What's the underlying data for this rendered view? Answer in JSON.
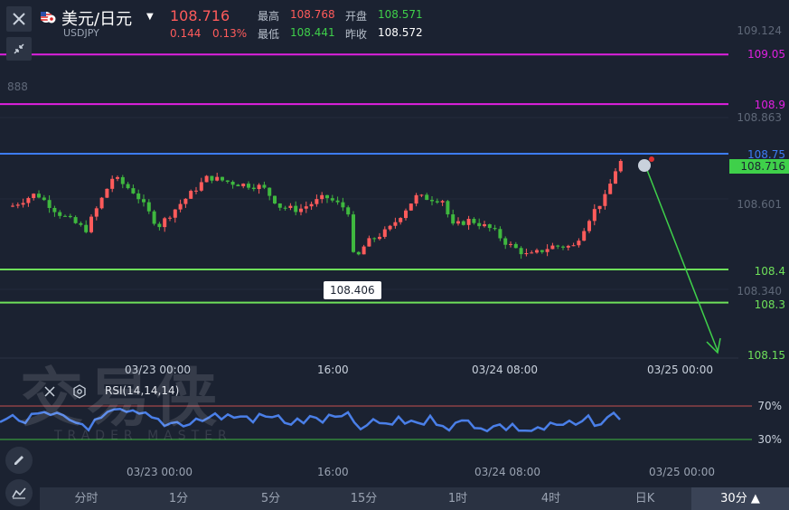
{
  "header": {
    "title": "美元/日元",
    "symbol": "USDJPY",
    "price": "108.716",
    "change": "0.144",
    "change_pct": "0.13%",
    "high_label": "最高",
    "high_value": "108.768",
    "low_label": "最低",
    "low_value": "108.441",
    "open_label": "开盘",
    "open_value": "108.571",
    "prev_close_label": "昨收",
    "prev_close_value": "108.572"
  },
  "y_axis": {
    "ticks": [
      "109.124",
      "888",
      "108.863",
      "108.601",
      "108.340"
    ]
  },
  "levels": [
    {
      "value": "109.05",
      "color": "#e020e0"
    },
    {
      "value": "108.9",
      "color": "#e020e0"
    },
    {
      "value": "108.75",
      "color": "#3d7cf5"
    },
    {
      "value": "108.4",
      "color": "#6ee05a"
    },
    {
      "value": "108.3",
      "color": "#6ee05a"
    },
    {
      "value": "108.15",
      "color": "#6ee05a"
    }
  ],
  "current_price_tag": "108.716",
  "low_tooltip": "108.406",
  "x_axis_main": [
    "03/23 00:00",
    "16:00",
    "03/24 08:00",
    "03/25 00:00"
  ],
  "x_axis_rsi": [
    "03/23 00:00",
    "16:00",
    "03/24 08:00",
    "03/25 00:00"
  ],
  "rsi": {
    "label": "RSI(14,14,14)",
    "upper": "70%",
    "lower": "30%"
  },
  "watermark": {
    "main": "交易侠",
    "sub": "TRADER MASTER"
  },
  "timeframes": [
    "分时",
    "1分",
    "5分",
    "15分",
    "1时",
    "4时",
    "日K",
    "30分"
  ],
  "active_timeframe": "30分",
  "colors": {
    "up": "#ff5b5b",
    "down": "#3fb83f",
    "bg": "#1b2231",
    "rsi_line": "#4a7fe8"
  },
  "chart_data": {
    "type": "candlestick",
    "x": [
      "03/23 00:00",
      "16:00",
      "03/24 08:00",
      "03/25 00:00"
    ],
    "ohlc_summary": {
      "open": 108.571,
      "high": 108.768,
      "low": 108.441,
      "close": 108.716
    },
    "horizontal_levels": [
      109.05,
      108.9,
      108.75,
      108.4,
      108.3,
      108.15
    ],
    "annotated_low": 108.406,
    "projection_target": 108.15
  }
}
